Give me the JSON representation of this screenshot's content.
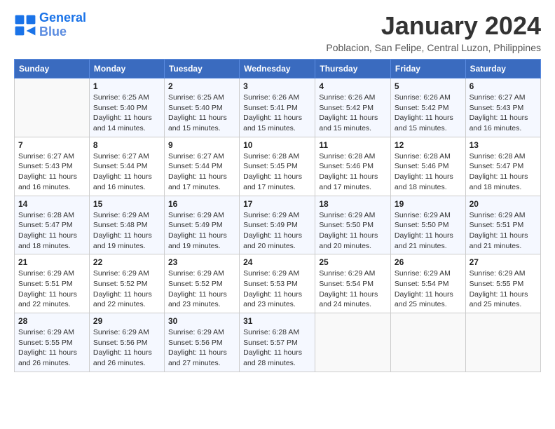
{
  "header": {
    "logo_line1": "General",
    "logo_line2": "Blue",
    "title": "January 2024",
    "subtitle": "Poblacion, San Felipe, Central Luzon, Philippines"
  },
  "weekdays": [
    "Sunday",
    "Monday",
    "Tuesday",
    "Wednesday",
    "Thursday",
    "Friday",
    "Saturday"
  ],
  "weeks": [
    [
      {
        "day": "",
        "info": ""
      },
      {
        "day": "1",
        "info": "Sunrise: 6:25 AM\nSunset: 5:40 PM\nDaylight: 11 hours\nand 14 minutes."
      },
      {
        "day": "2",
        "info": "Sunrise: 6:25 AM\nSunset: 5:40 PM\nDaylight: 11 hours\nand 15 minutes."
      },
      {
        "day": "3",
        "info": "Sunrise: 6:26 AM\nSunset: 5:41 PM\nDaylight: 11 hours\nand 15 minutes."
      },
      {
        "day": "4",
        "info": "Sunrise: 6:26 AM\nSunset: 5:42 PM\nDaylight: 11 hours\nand 15 minutes."
      },
      {
        "day": "5",
        "info": "Sunrise: 6:26 AM\nSunset: 5:42 PM\nDaylight: 11 hours\nand 15 minutes."
      },
      {
        "day": "6",
        "info": "Sunrise: 6:27 AM\nSunset: 5:43 PM\nDaylight: 11 hours\nand 16 minutes."
      }
    ],
    [
      {
        "day": "7",
        "info": "Sunrise: 6:27 AM\nSunset: 5:43 PM\nDaylight: 11 hours\nand 16 minutes."
      },
      {
        "day": "8",
        "info": "Sunrise: 6:27 AM\nSunset: 5:44 PM\nDaylight: 11 hours\nand 16 minutes."
      },
      {
        "day": "9",
        "info": "Sunrise: 6:27 AM\nSunset: 5:44 PM\nDaylight: 11 hours\nand 17 minutes."
      },
      {
        "day": "10",
        "info": "Sunrise: 6:28 AM\nSunset: 5:45 PM\nDaylight: 11 hours\nand 17 minutes."
      },
      {
        "day": "11",
        "info": "Sunrise: 6:28 AM\nSunset: 5:46 PM\nDaylight: 11 hours\nand 17 minutes."
      },
      {
        "day": "12",
        "info": "Sunrise: 6:28 AM\nSunset: 5:46 PM\nDaylight: 11 hours\nand 18 minutes."
      },
      {
        "day": "13",
        "info": "Sunrise: 6:28 AM\nSunset: 5:47 PM\nDaylight: 11 hours\nand 18 minutes."
      }
    ],
    [
      {
        "day": "14",
        "info": "Sunrise: 6:28 AM\nSunset: 5:47 PM\nDaylight: 11 hours\nand 18 minutes."
      },
      {
        "day": "15",
        "info": "Sunrise: 6:29 AM\nSunset: 5:48 PM\nDaylight: 11 hours\nand 19 minutes."
      },
      {
        "day": "16",
        "info": "Sunrise: 6:29 AM\nSunset: 5:49 PM\nDaylight: 11 hours\nand 19 minutes."
      },
      {
        "day": "17",
        "info": "Sunrise: 6:29 AM\nSunset: 5:49 PM\nDaylight: 11 hours\nand 20 minutes."
      },
      {
        "day": "18",
        "info": "Sunrise: 6:29 AM\nSunset: 5:50 PM\nDaylight: 11 hours\nand 20 minutes."
      },
      {
        "day": "19",
        "info": "Sunrise: 6:29 AM\nSunset: 5:50 PM\nDaylight: 11 hours\nand 21 minutes."
      },
      {
        "day": "20",
        "info": "Sunrise: 6:29 AM\nSunset: 5:51 PM\nDaylight: 11 hours\nand 21 minutes."
      }
    ],
    [
      {
        "day": "21",
        "info": "Sunrise: 6:29 AM\nSunset: 5:51 PM\nDaylight: 11 hours\nand 22 minutes."
      },
      {
        "day": "22",
        "info": "Sunrise: 6:29 AM\nSunset: 5:52 PM\nDaylight: 11 hours\nand 22 minutes."
      },
      {
        "day": "23",
        "info": "Sunrise: 6:29 AM\nSunset: 5:52 PM\nDaylight: 11 hours\nand 23 minutes."
      },
      {
        "day": "24",
        "info": "Sunrise: 6:29 AM\nSunset: 5:53 PM\nDaylight: 11 hours\nand 23 minutes."
      },
      {
        "day": "25",
        "info": "Sunrise: 6:29 AM\nSunset: 5:54 PM\nDaylight: 11 hours\nand 24 minutes."
      },
      {
        "day": "26",
        "info": "Sunrise: 6:29 AM\nSunset: 5:54 PM\nDaylight: 11 hours\nand 25 minutes."
      },
      {
        "day": "27",
        "info": "Sunrise: 6:29 AM\nSunset: 5:55 PM\nDaylight: 11 hours\nand 25 minutes."
      }
    ],
    [
      {
        "day": "28",
        "info": "Sunrise: 6:29 AM\nSunset: 5:55 PM\nDaylight: 11 hours\nand 26 minutes."
      },
      {
        "day": "29",
        "info": "Sunrise: 6:29 AM\nSunset: 5:56 PM\nDaylight: 11 hours\nand 26 minutes."
      },
      {
        "day": "30",
        "info": "Sunrise: 6:29 AM\nSunset: 5:56 PM\nDaylight: 11 hours\nand 27 minutes."
      },
      {
        "day": "31",
        "info": "Sunrise: 6:28 AM\nSunset: 5:57 PM\nDaylight: 11 hours\nand 28 minutes."
      },
      {
        "day": "",
        "info": ""
      },
      {
        "day": "",
        "info": ""
      },
      {
        "day": "",
        "info": ""
      }
    ]
  ]
}
